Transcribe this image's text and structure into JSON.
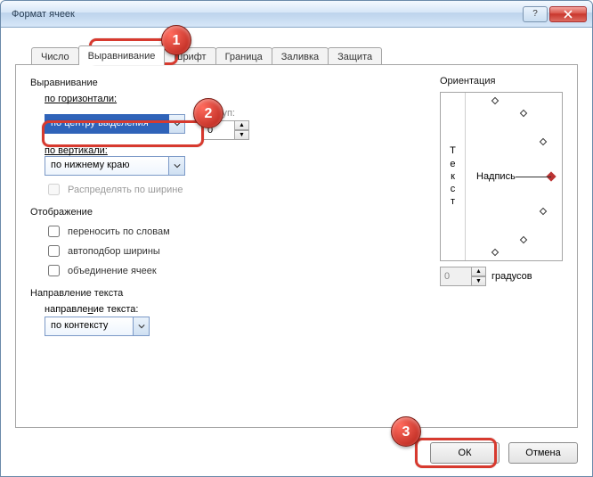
{
  "window": {
    "title": "Формат ячеек"
  },
  "tabs": [
    "Число",
    "Выравнивание",
    "Шрифт",
    "Граница",
    "Заливка",
    "Защита"
  ],
  "active_tab": 1,
  "align": {
    "group_label": "Выравнивание",
    "h_label": "по горизонтали:",
    "h_value": "по центру выделения",
    "indent_label": "отступ:",
    "indent_value": "0",
    "v_label": "по вертикали:",
    "v_value": "по нижнему краю",
    "distribute_label": "Распределять по ширине"
  },
  "display": {
    "group_label": "Отображение",
    "wrap_label": "переносить по словам",
    "autofit_label": "автоподбор ширины",
    "merge_label": "объединение ячеек"
  },
  "direction": {
    "group_label": "Направление текста",
    "label": "направление текста:",
    "value": "по контексту"
  },
  "orient": {
    "group_label": "Ориентация",
    "vtext": "Текст",
    "label": "Надпись",
    "deg_value": "0",
    "deg_unit": "градусов"
  },
  "buttons": {
    "ok": "ОК",
    "cancel": "Отмена"
  },
  "badges": {
    "b1": "1",
    "b2": "2",
    "b3": "3"
  }
}
